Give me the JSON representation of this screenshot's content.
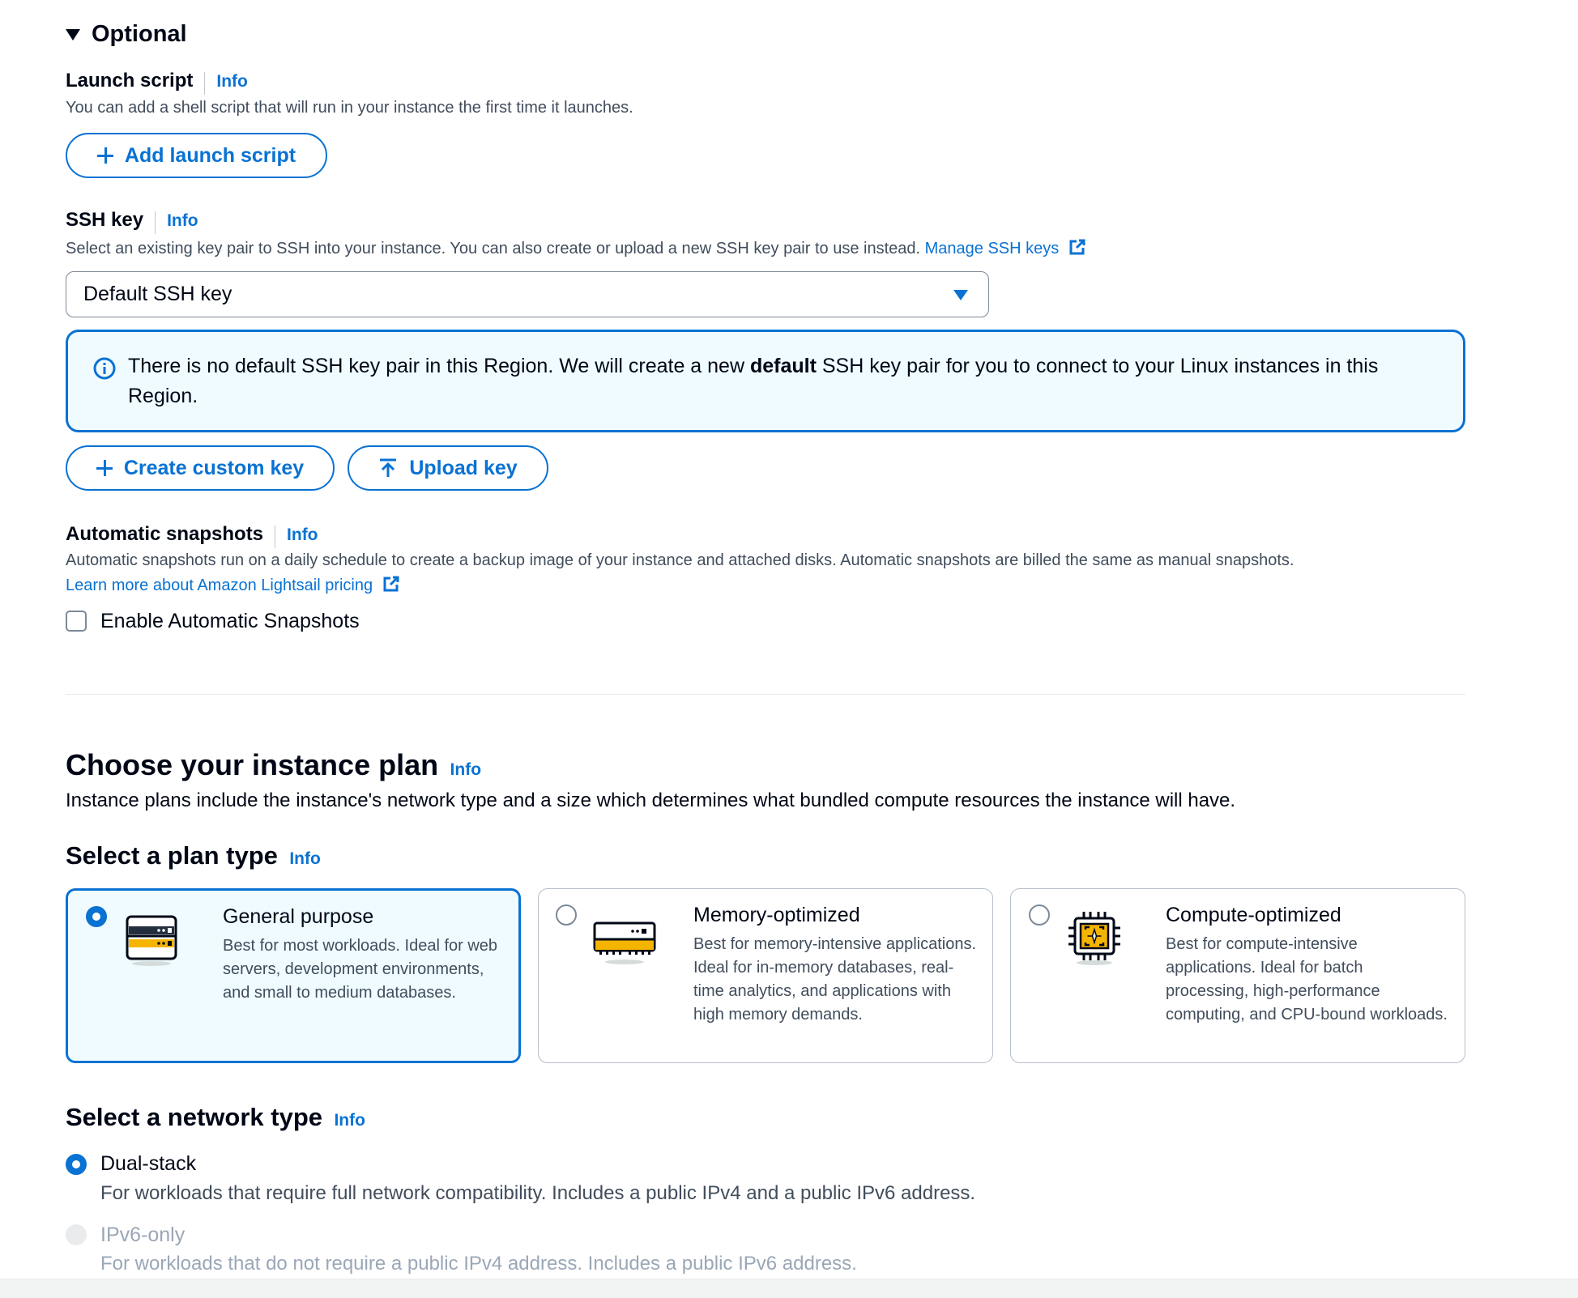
{
  "optional": {
    "title": "Optional"
  },
  "launch_script": {
    "label": "Launch script",
    "info": "Info",
    "description": "You can add a shell script that will run in your instance the first time it launches.",
    "button": "Add launch script"
  },
  "ssh_key": {
    "label": "SSH key",
    "info": "Info",
    "description": "Select an existing key pair to SSH into your instance. You can also create or upload a new SSH key pair to use instead.",
    "manage_link": "Manage SSH keys",
    "selected": "Default SSH key",
    "alert_part1": "There is no default SSH key pair in this Region. We will create a new ",
    "alert_bold": "default",
    "alert_part2": " SSH key pair for you to connect to your Linux instances in this Region.",
    "create_button": "Create custom key",
    "upload_button": "Upload key"
  },
  "snapshots": {
    "label": "Automatic snapshots",
    "info": "Info",
    "description": "Automatic snapshots run on a daily schedule to create a backup image of your instance and attached disks. Automatic snapshots are billed the same as manual snapshots.",
    "pricing_link": "Learn more about Amazon Lightsail pricing",
    "checkbox_label": "Enable Automatic Snapshots",
    "checked": false
  },
  "instance_plan": {
    "title": "Choose your instance plan",
    "info": "Info",
    "description": "Instance plans include the instance's network type and a size which determines what bundled compute resources the instance will have."
  },
  "plan_type": {
    "title": "Select a plan type",
    "info": "Info",
    "options": [
      {
        "title": "General purpose",
        "description": "Best for most workloads. Ideal for web servers, development environments, and small to medium databases.",
        "icon": "server-rack-icon",
        "selected": true
      },
      {
        "title": "Memory-optimized",
        "description": "Best for memory-intensive applications. Ideal for in-memory databases, real-time analytics, and applications with high memory demands.",
        "icon": "memory-module-icon",
        "selected": false
      },
      {
        "title": "Compute-optimized",
        "description": "Best for compute-intensive applications. Ideal for batch processing, high-performance computing, and CPU-bound workloads.",
        "icon": "cpu-chip-icon",
        "selected": false
      }
    ]
  },
  "network_type": {
    "title": "Select a network type",
    "info": "Info",
    "options": [
      {
        "label": "Dual-stack",
        "description": "For workloads that require full network compatibility. Includes a public IPv4 and a public IPv6 address.",
        "selected": true,
        "disabled": false
      },
      {
        "label": "IPv6-only",
        "description": "For workloads that do not require a public IPv4 address. Includes a public IPv6 address.",
        "selected": false,
        "disabled": true
      }
    ]
  },
  "colors": {
    "accent": "#0972d3",
    "alert_bg": "#f0fbff",
    "text": "#000716",
    "secondary_text": "#414d5c",
    "icon_yellow": "#f5b400"
  }
}
